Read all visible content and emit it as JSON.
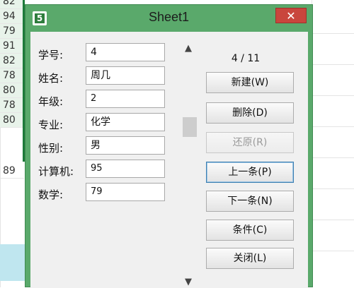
{
  "sheet": {
    "row_values": [
      "82",
      "94",
      "79",
      "91",
      "82",
      "78",
      "80",
      "78",
      "80",
      "89"
    ]
  },
  "dialog": {
    "title": "Sheet1",
    "close_label": "✕",
    "app_icon_glyph": "5",
    "record_counter": "4 / 11",
    "fields": [
      {
        "label": "学号:",
        "value": "4"
      },
      {
        "label": "姓名:",
        "value": "周几"
      },
      {
        "label": "年级:",
        "value": "2"
      },
      {
        "label": "专业:",
        "value": "化学"
      },
      {
        "label": "性别:",
        "value": "男"
      },
      {
        "label": "计算机:",
        "value": "95"
      },
      {
        "label": "数学:",
        "value": "79"
      }
    ],
    "buttons": {
      "new": "新建(W)",
      "delete": "删除(D)",
      "restore": "还原(R)",
      "prev": "上一条(P)",
      "next": "下一条(N)",
      "criteria": "条件(C)",
      "close": "关闭(L)"
    }
  },
  "colors": {
    "window_frame": "#5aa96b",
    "close_button": "#c9463d",
    "selection_border": "#1e7a3a"
  }
}
